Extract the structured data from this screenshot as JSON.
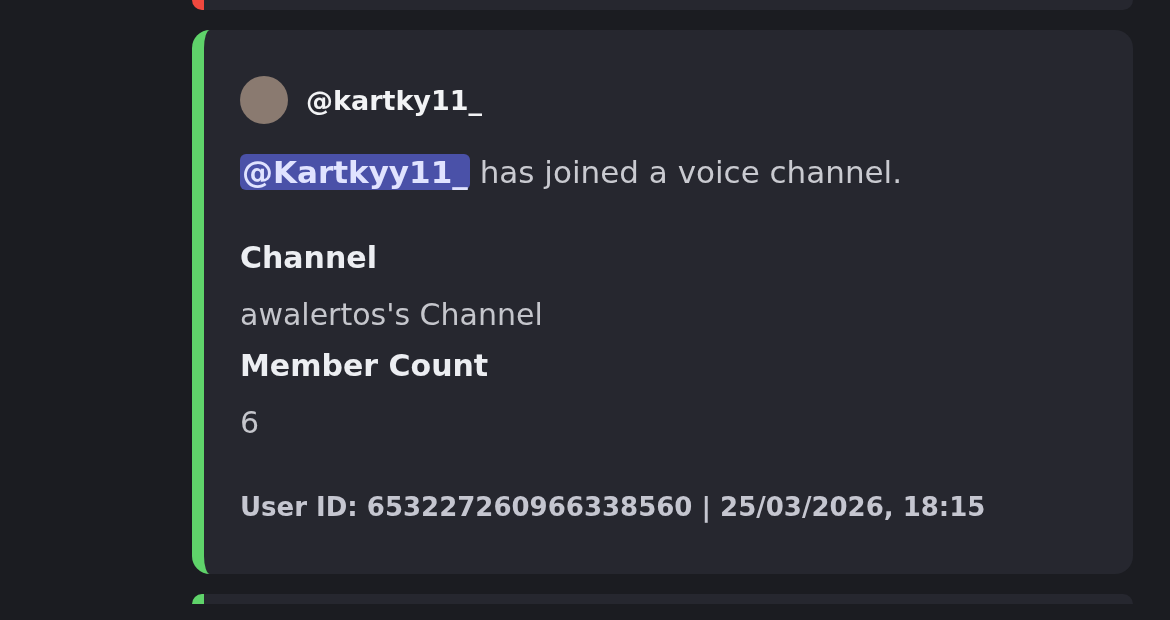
{
  "embeds": [
    {
      "kind": "clipped_top",
      "color": "#f0483e"
    },
    {
      "kind": "full",
      "color": "#5fd36a",
      "author": "@kartky11_",
      "mention": "@Kartkyy11_",
      "description": "has joined a voice channel.",
      "fields": [
        {
          "name": "Channel",
          "value": "awalertos's Channel"
        },
        {
          "name": "Member Count",
          "value": "6"
        }
      ],
      "footer": "User ID: 653227260966338560 | 25/03/2026, 18:15"
    },
    {
      "kind": "clipped_bottom",
      "color": "#5fd36a"
    }
  ]
}
